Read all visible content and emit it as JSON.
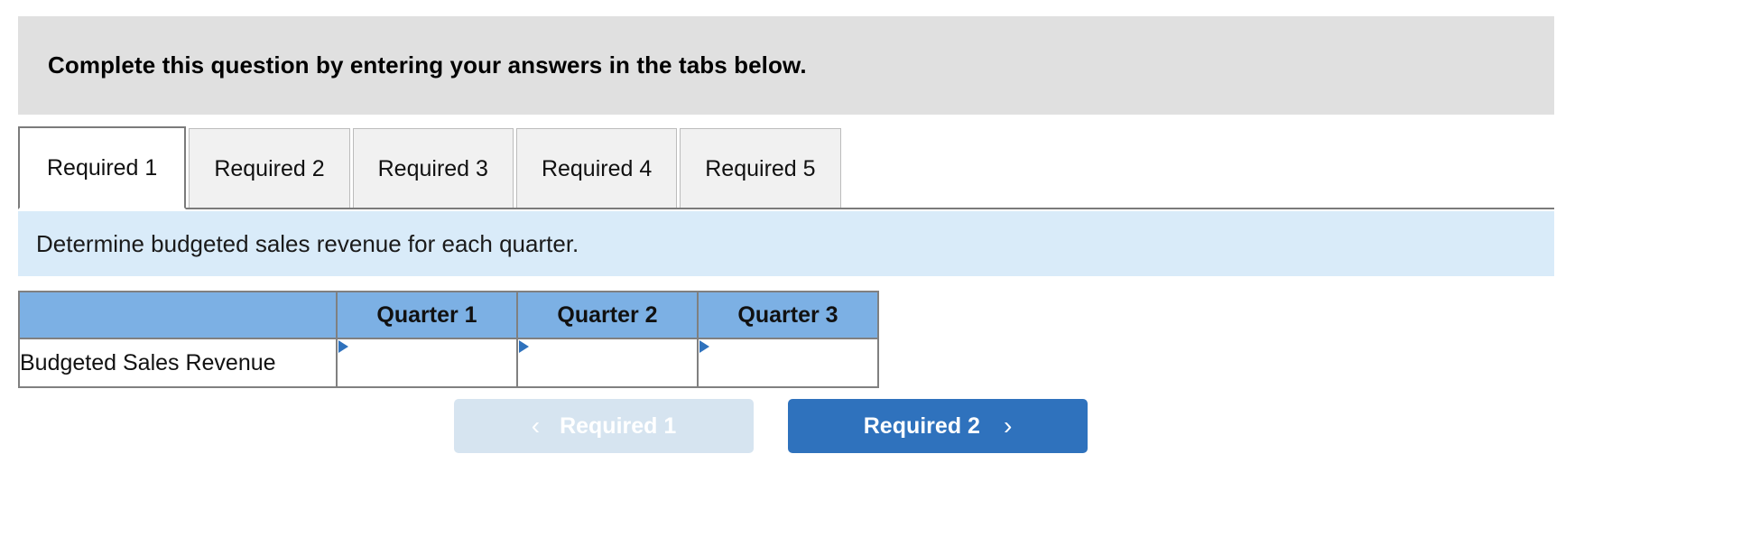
{
  "banner": {
    "text": "Complete this question by entering your answers in the tabs below."
  },
  "tabs": {
    "active_index": 0,
    "items": [
      {
        "label": "Required 1"
      },
      {
        "label": "Required 2"
      },
      {
        "label": "Required 3"
      },
      {
        "label": "Required 4"
      },
      {
        "label": "Required 5"
      }
    ]
  },
  "subbar": {
    "text": "Determine budgeted sales revenue for each quarter."
  },
  "table": {
    "columns": [
      "",
      "Quarter 1",
      "Quarter 2",
      "Quarter 3"
    ],
    "rows": [
      {
        "label": "Budgeted Sales Revenue",
        "cells": [
          {
            "value": "",
            "placeholder": ""
          },
          {
            "value": "",
            "placeholder": ""
          },
          {
            "value": "",
            "placeholder": ""
          }
        ]
      }
    ]
  },
  "navigation": {
    "prev_label": "Required 1",
    "next_label": "Required 2",
    "prev_icon": "chevron-left-icon",
    "next_icon": "chevron-right-icon",
    "prev_chevron": "‹",
    "next_chevron": "›",
    "prev_disabled": true
  },
  "colors": {
    "banner_bg": "#e0e0e0",
    "subbar_bg": "#d9ebf9",
    "table_header_bg": "#7cb0e4",
    "input_border": "#2f72bd",
    "accent_blue": "#2f72bd",
    "disabled_btn_bg": "#d6e4f0",
    "tab_inactive_bg": "#f1f1f1",
    "border_gray": "#808080"
  }
}
